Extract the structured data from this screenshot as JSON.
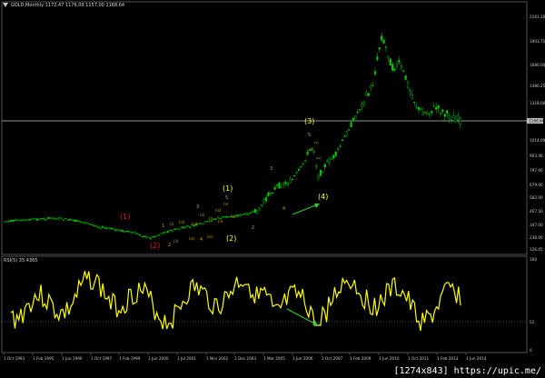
{
  "window": {
    "title": "GOLD,Monthly  1172.47 1176.09 1157.00 1168.64",
    "rsi_title": "RSI(5) 35.4365",
    "watermark": "[1274x843] https://upic.me/"
  },
  "colors": {
    "background": "#000000",
    "bull_candle": "#00c800",
    "bear_candle": "#00c800",
    "wave_major": "#ffff33",
    "wave_minor": "#c8a020",
    "wave_red": "#e02020",
    "arrow": "#33cc33",
    "rsi_line": "#ffff00",
    "price_line": "#c0c0c0",
    "axis_text": "#c8c8c8"
  },
  "price_axis": {
    "labels": [
      "2161.20",
      "1903.75",
      "1680.00",
      "1486.25",
      "1318.00",
      "1168.64",
      "1014.00",
      "903.46",
      "797.00",
      "679.00",
      "582.00",
      "467.50",
      "347.00",
      "236.00",
      "126.05"
    ]
  },
  "rsi_axis": {
    "labels": [
      "100",
      "52",
      "0"
    ],
    "level_label": "52"
  },
  "time_axis": {
    "labels": [
      "1 Oct 1993",
      "1 Feb 1995",
      "1 Jun 1996",
      "1 Oct 1997",
      "1 Feb 1999",
      "1 Jun 2000",
      "1 Jul 2001",
      "1 Nov 2002",
      "1 Dec 2003",
      "1 Mar 2005",
      "1 Jun 2006",
      "1 Oct 2007",
      "1 Feb 2009",
      "1 Jun 2010",
      "1 Oct 2011",
      "1 Feb 2013",
      "1 Jun 2014"
    ]
  },
  "current_price": "1168.64",
  "wave_labels": {
    "w1_red": "(1)",
    "w2_red": "(2)",
    "w1_major": "(1)",
    "w2_major": "(2)",
    "w3_major": "(3)",
    "w4_major": "(4)",
    "minor_1": "1",
    "minor_2": "2",
    "minor_3": "3",
    "minor_4": "4",
    "minor_5": "5",
    "sub_i": "(i)",
    "sub_ii": "(ii)",
    "sub_iii": "(iii)",
    "sub_iv": "(iv)",
    "sub_v": "(v)",
    "mid_2": "2",
    "mid_3": "3",
    "mid_4": "4",
    "mid_5": "5"
  }
}
